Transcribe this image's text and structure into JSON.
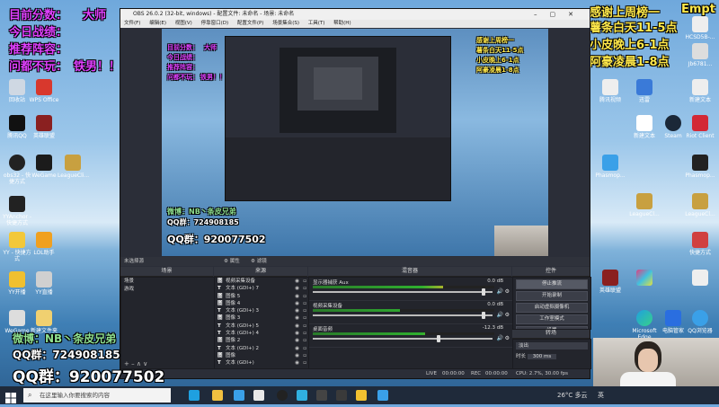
{
  "overlay": {
    "topleft": [
      "目前分数：",
      "大师",
      "今日战绩：",
      "推荐阵容：",
      "问都不玩：",
      "铁男！！"
    ],
    "topright": [
      "感谢上周榜一",
      "Empt",
      "薯条白天11-5点",
      "小皮晚上6-1点",
      "阿豪凌晨1-8点"
    ],
    "bottomleft": [
      "微博：NB丶条皮兄弟",
      "QQ群：",
      "724908185",
      "QQ群：",
      "920077502"
    ]
  },
  "desktop_left": [
    "回收站",
    "WPS Office",
    "腾讯QQ",
    "英雄联盟",
    "obs32 - 快捷方式",
    "WeGame",
    "YYAnchor - 快捷方式",
    "LeagueCli...",
    "YY - 快捷方式",
    "LOL助手",
    "YY开播",
    "YY直播",
    "WeGame",
    "新建文件夹"
  ],
  "desktop_right": [
    "HCSD5B-...",
    "IMG.jpg",
    "Jb6781...",
    "腾讯视频",
    "迅雷",
    "新建文本",
    "Edge",
    "QQ音乐",
    "Steam",
    "Riot Client",
    "Phasmop...",
    "LeagueCl...",
    "快捷方式",
    "Microsoft Edge",
    "电脑管家",
    "QQ浏览器"
  ],
  "obs": {
    "title": "OBS 26.0.2 (32-bit, windows) - 配置文件: 未命名 - 场景: 未命名",
    "menus": [
      "文件(F)",
      "编辑(E)",
      "视图(V)",
      "停靠窗口(D)",
      "配置文件(P)",
      "场景集合(S)",
      "工具(T)",
      "帮助(H)"
    ],
    "no_source_label": "未选择源",
    "props_label": "属性",
    "filters_label": "滤镜",
    "scenes_header": "场景",
    "scenes": [
      "场景",
      "游戏"
    ],
    "sources_header": "来源",
    "sources": [
      {
        "type": "图",
        "name": "视频采集设备"
      },
      {
        "type": "T",
        "name": "文本 (GDI+) 7"
      },
      {
        "type": "图",
        "name": "图像 5"
      },
      {
        "type": "图",
        "name": "图像 4"
      },
      {
        "type": "T",
        "name": "文本 (GDI+) 3"
      },
      {
        "type": "图",
        "name": "图像 3"
      },
      {
        "type": "T",
        "name": "文本 (GDI+) 5"
      },
      {
        "type": "T",
        "name": "文本 (GDI+) 4"
      },
      {
        "type": "图",
        "name": "图像 2"
      },
      {
        "type": "T",
        "name": "文本 (GDI+) 2"
      },
      {
        "type": "图",
        "name": "图像"
      },
      {
        "type": "T",
        "name": "文本 (GDI+)"
      }
    ],
    "mixer_header": "混音器",
    "mixer": [
      {
        "name": "显示器捕获 Aux",
        "db": "0.0 dB",
        "level": 0.72,
        "volume": 0.95
      },
      {
        "name": "视频采集设备",
        "db": "0.0 dB",
        "level": 0.48,
        "volume": 0.95
      },
      {
        "name": "桌面音频",
        "db": "-12.3 dB",
        "level": 0.62,
        "volume": 0.7
      }
    ],
    "transitions_header": "转场",
    "transition_label": "淡出",
    "duration_label": "时长",
    "duration_value": "300 ms",
    "controls_header": "控件",
    "controls": [
      "停止推流",
      "开始录制",
      "启动虚拟摄像机",
      "工作室模式",
      "设置",
      "退出"
    ],
    "status": {
      "live": "LIVE",
      "live_time": "00:00:00",
      "rec": "REC",
      "rec_time": "00:00:00",
      "cpu": "CPU: 2.7%, 30.00 fps"
    }
  },
  "taskbar": {
    "search_placeholder": "在这里输入你要搜索的内容",
    "temp": "26°C 多云",
    "ime": "英"
  }
}
